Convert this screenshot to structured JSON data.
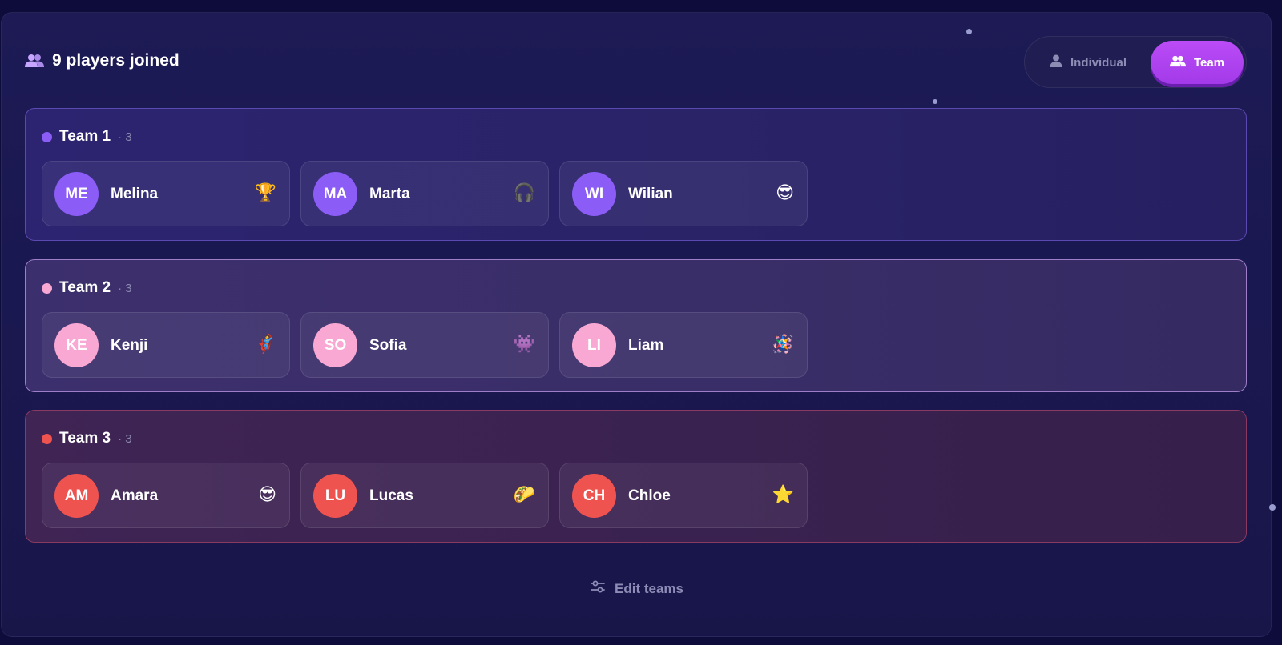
{
  "header": {
    "title": "9 players joined",
    "icon": "users-icon"
  },
  "mode_toggle": {
    "individual_label": "Individual",
    "team_label": "Team",
    "selected": "Team",
    "accent": "#b044f0"
  },
  "teams": [
    {
      "name": "Team 1",
      "count": "· 3",
      "color": "#8b5cf6",
      "players": [
        {
          "initials": "ME",
          "name": "Melina",
          "emoji": "🏆"
        },
        {
          "initials": "MA",
          "name": "Marta",
          "emoji": "🎧"
        },
        {
          "initials": "WI",
          "name": "Wilian",
          "emoji": "😎"
        }
      ]
    },
    {
      "name": "Team 2",
      "count": "· 3",
      "color": "#f9a8d4",
      "players": [
        {
          "initials": "KE",
          "name": "Kenji",
          "emoji": "🦸"
        },
        {
          "initials": "SO",
          "name": "Sofia",
          "emoji": "👾"
        },
        {
          "initials": "LI",
          "name": "Liam",
          "emoji": "🪅"
        }
      ]
    },
    {
      "name": "Team 3",
      "count": "· 3",
      "color": "#ef5350",
      "players": [
        {
          "initials": "AM",
          "name": "Amara",
          "emoji": "😎"
        },
        {
          "initials": "LU",
          "name": "Lucas",
          "emoji": "🌮"
        },
        {
          "initials": "CH",
          "name": "Chloe",
          "emoji": "⭐"
        }
      ]
    }
  ],
  "footer": {
    "edit_label": "Edit teams",
    "icon": "sliders-icon"
  }
}
